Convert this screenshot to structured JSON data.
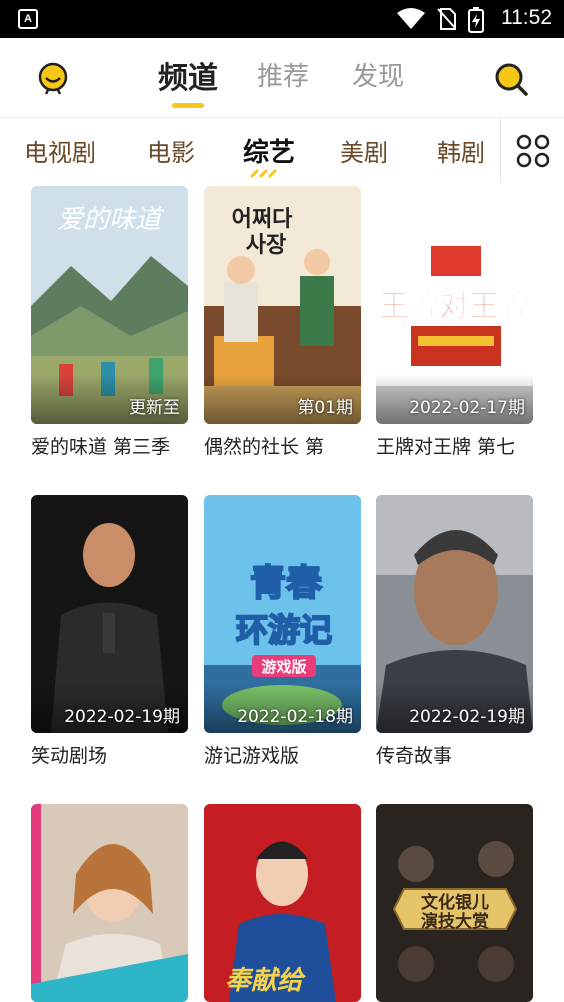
{
  "status_bar": {
    "app_badge": "A",
    "time": "11:52"
  },
  "header": {
    "tabs": [
      {
        "label": "频道"
      },
      {
        "label": "推荐"
      },
      {
        "label": "发现"
      }
    ]
  },
  "categories": [
    {
      "label": "电视剧"
    },
    {
      "label": "电影"
    },
    {
      "label": "综艺"
    },
    {
      "label": "美剧"
    },
    {
      "label": "韩剧"
    }
  ],
  "cards": [
    {
      "title": "爱的味道 第三季",
      "badge": "更新至"
    },
    {
      "title": "偶然的社长 第",
      "badge": "第01期"
    },
    {
      "title": "王牌对王牌 第七",
      "badge": "2022-02-17期"
    },
    {
      "title": "笑动剧场",
      "badge": "2022-02-19期"
    },
    {
      "title": "游记游戏版",
      "badge": "2022-02-18期"
    },
    {
      "title": "传奇故事",
      "badge": "2022-02-19期"
    },
    {
      "title": "",
      "badge": ""
    },
    {
      "title": "",
      "badge": ""
    },
    {
      "title": "",
      "badge": ""
    }
  ],
  "posters": {
    "p1": "爱的味道",
    "p2a": "어쩌다",
    "p2b": "사장",
    "p3": "王牌对王牌",
    "p5a": "青春",
    "p5b": "环游记",
    "p5c": "游戏版",
    "p9a": "文化银儿",
    "p9b": "演技大赏",
    "p8": "奉献给"
  },
  "icons": {
    "mascot": "mascot-icon",
    "search": "search-icon",
    "grid": "grid-menu-icon"
  },
  "colors": {
    "accent": "#f6c716",
    "category_text": "#6b4a2a"
  }
}
